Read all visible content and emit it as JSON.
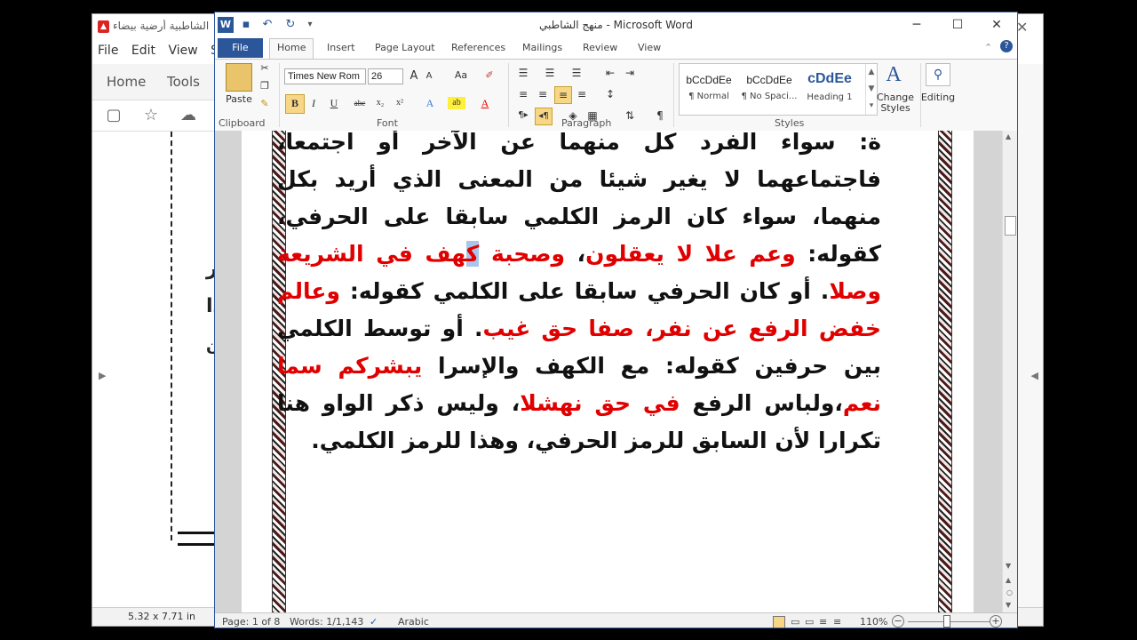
{
  "pdf_viewer": {
    "title": "الشاطبية أرضية بيضاء",
    "pdf_icon": "pdf-icon",
    "menu": [
      "File",
      "Edit",
      "View",
      "Si"
    ],
    "tabs": [
      "Home",
      "Tools"
    ],
    "tool_icons": [
      "save-icon",
      "star-icon",
      "cloud-upload-icon"
    ],
    "page_size": "5.32 x 7.71 in",
    "text_fragments": [
      "ير",
      "ذا",
      "ن"
    ]
  },
  "word": {
    "window_title": "منهج الشاطبي - Microsoft Word",
    "tabs": [
      "File",
      "Home",
      "Insert",
      "Page Layout",
      "References",
      "Mailings",
      "Review",
      "View"
    ],
    "ribbon": {
      "paste_label": "Paste",
      "clipboard_group": "Clipboard",
      "font_name": "Times New Rom",
      "font_size": "26",
      "font_group": "Font",
      "paragraph_group": "Paragraph",
      "styles_group": "Styles",
      "styles": [
        {
          "sample": "bCcDdEe",
          "name": "¶ Normal"
        },
        {
          "sample": "bCcDdEe",
          "name": "¶ No Spaci..."
        },
        {
          "sample": "cDdEe",
          "name": "Heading 1"
        }
      ],
      "change_styles_label": "Change Styles",
      "editing_label": "Editing"
    },
    "document": {
      "p0": "ة: سواء الفرد كل منهما عن الآخر أو اجتمعا، فاجتماعهما",
      "p1": "لا يغير شيئا من المعنى الذي أريد بكل منهما، سواء كان",
      "p2": "الرمز الكلمي سابقا على الحرفي، كقوله: ",
      "r1": "وعم علا لا يعقلون",
      "p3": "، ",
      "r2a": "وصحبة ",
      "r2sel": "ك",
      "r2b": "هف في الشريعة وصلا",
      "p4": ". أو كان الحرفي سابقا على الكلمي كقوله: ",
      "r3": "وعالم خفض الرفع عن نفر، صفا حق غيب",
      "p5": ". أو توسط الكلمي بين حرفين كقوله: مع الكهف والإسرا ",
      "r4": "يبشركم سما نعم",
      "p6": "،ولباس الرفع ",
      "r5": "في حق نهشلا",
      "p7": "، وليس ذكر الواو هنا تكرارا لأن السابق للرمز الحرفي، وهذا للرمز الكلمي."
    },
    "status": {
      "page": "Page: 1 of 8",
      "words": "Words: 1/1,143",
      "language": "Arabic",
      "zoom": "110%"
    }
  }
}
